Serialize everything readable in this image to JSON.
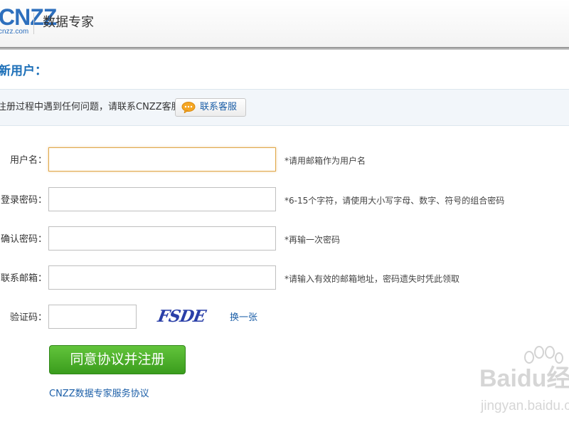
{
  "header": {
    "logo_main": "CNZZ",
    "logo_sub": "cnzz.com",
    "product_name": "数据专家"
  },
  "page_title": "新用户：",
  "notice": {
    "text": "注册过程中遇到任何问题，请联系CNZZ客服",
    "service_button": "联系客服"
  },
  "form": {
    "username": {
      "label": "用户名：",
      "value": "",
      "hint": "*请用邮箱作为用户名"
    },
    "password": {
      "label": "登录密码：",
      "value": "",
      "hint": "*6-15个字符，请使用大小写字母、数字、符号的组合密码"
    },
    "confirm_password": {
      "label": "确认密码：",
      "value": "",
      "hint": "*再输一次密码"
    },
    "contact_email": {
      "label": "联系邮箱：",
      "value": "",
      "hint": "*请输入有效的邮箱地址，密码遗失时凭此领取"
    },
    "captcha": {
      "label": "验证码：",
      "value": "",
      "image_text": "FSDE",
      "refresh_label": "换一张"
    }
  },
  "submit_label": "同意协议并注册",
  "agreement_link": "CNZZ数据专家服务协议",
  "watermark": {
    "text": "Baidu经验",
    "sub": "jingyan.baidu.com"
  },
  "colors": {
    "link": "#1c5fa8",
    "title": "#1c6fb8",
    "submit": "#3a9d1d",
    "focus": "#e0a84a"
  }
}
